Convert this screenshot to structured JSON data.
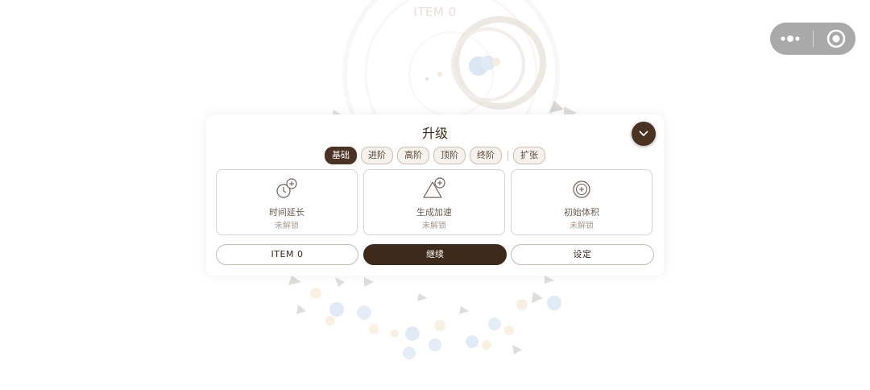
{
  "background": {
    "score_text": "ITEM 0"
  },
  "capsule": {
    "more_icon": "more-dots-icon",
    "close_icon": "target-close-icon"
  },
  "dialog": {
    "title": "升级",
    "collapse_icon": "chevron-down-icon",
    "tabs": [
      {
        "label": "基础",
        "active": true
      },
      {
        "label": "进阶",
        "active": false
      },
      {
        "label": "高阶",
        "active": false
      },
      {
        "label": "顶阶",
        "active": false
      },
      {
        "label": "终阶",
        "active": false
      },
      {
        "label": "扩张",
        "active": false
      }
    ],
    "cards": [
      {
        "name": "时间延长",
        "status": "未解锁",
        "icon": "clock-plus-icon"
      },
      {
        "name": "生成加速",
        "status": "未解锁",
        "icon": "triangle-plus-icon"
      },
      {
        "name": "初始体积",
        "status": "未解锁",
        "icon": "circle-plus-icon"
      }
    ],
    "buttons": {
      "item": "ITEM  0",
      "continue": "继续",
      "settings": "设定"
    }
  },
  "colors": {
    "accent_dark": "#3e2a1b",
    "capsule_bg": "#a9a9a9",
    "tab_border": "#c9bfb3"
  }
}
